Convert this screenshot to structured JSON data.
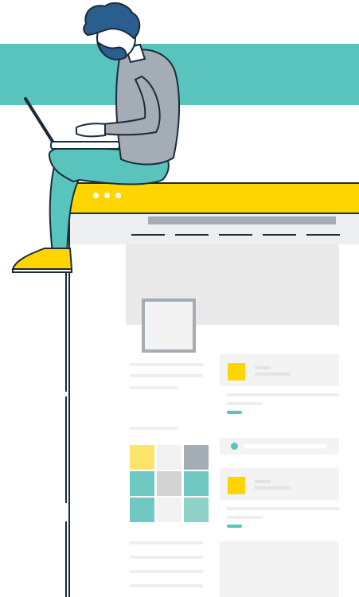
{
  "colors": {
    "teal": "#58c4bd",
    "yellow": "#fed500",
    "navy": "#1c2b3a",
    "hair": "#2a5e8e",
    "sweater": "#a4adb5",
    "pants": "#58c4bd",
    "gray_light": "#f3f3f3"
  },
  "illustration": {
    "subject": "person-with-laptop-sitting-on-browser-window",
    "icons": [
      "laptop-icon",
      "browser-dots-icon",
      "image-placeholder-icon"
    ]
  },
  "grid": {
    "rows": 3,
    "cols": 3,
    "colors": [
      "#fde46a",
      "#f2f2f2",
      "#a4adb5",
      "#6fc9c2",
      "#d3d3d3",
      "#6fc9c2",
      "#6fc9c2",
      "#f2f2f2",
      "#8fd0c9"
    ]
  }
}
